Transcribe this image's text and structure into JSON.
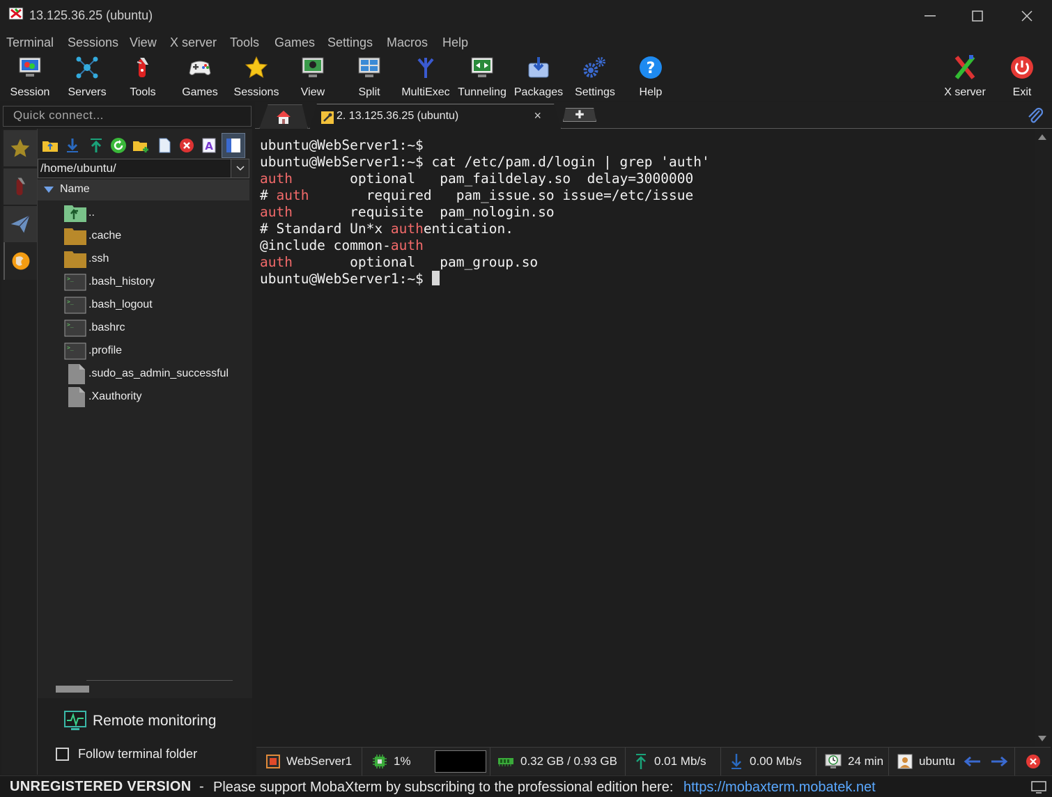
{
  "window": {
    "title": "13.125.36.25 (ubuntu)"
  },
  "menu": [
    "Terminal",
    "Sessions",
    "View",
    "X server",
    "Tools",
    "Games",
    "Settings",
    "Macros",
    "Help"
  ],
  "toolbar": {
    "session": "Session",
    "servers": "Servers",
    "tools": "Tools",
    "games": "Games",
    "sessions": "Sessions",
    "view": "View",
    "split": "Split",
    "multiexec": "MultiExec",
    "tunneling": "Tunneling",
    "packages": "Packages",
    "settings": "Settings",
    "help": "Help",
    "xserver": "X server",
    "exit": "Exit"
  },
  "quick_connect": {
    "placeholder": "Quick connect..."
  },
  "tabs": {
    "active_label": "2. 13.125.36.25 (ubuntu)",
    "close": "×",
    "new": "✚"
  },
  "sidebar": {
    "path": "/home/ubuntu/",
    "column": "Name",
    "files": [
      {
        "name": "..",
        "type": "up"
      },
      {
        "name": ".cache",
        "type": "folder"
      },
      {
        "name": ".ssh",
        "type": "folder"
      },
      {
        "name": ".bash_history",
        "type": "script"
      },
      {
        "name": ".bash_logout",
        "type": "script"
      },
      {
        "name": ".bashrc",
        "type": "script"
      },
      {
        "name": ".profile",
        "type": "script"
      },
      {
        "name": ".sudo_as_admin_successful",
        "type": "file"
      },
      {
        "name": ".Xauthority",
        "type": "file"
      }
    ],
    "remote_monitoring": "Remote monitoring",
    "follow_terminal": "Follow terminal folder"
  },
  "terminal": {
    "lines": [
      [
        {
          "t": "ubuntu@WebServer1:~$"
        }
      ],
      [
        {
          "t": "ubuntu@WebServer1:~$ cat /etc/pam.d/login | grep 'auth'"
        }
      ],
      [
        {
          "t": "auth",
          "c": "red"
        },
        {
          "t": "       optional   pam_faildelay.so  delay=3000000"
        }
      ],
      [
        {
          "t": "# "
        },
        {
          "t": "auth",
          "c": "red"
        },
        {
          "t": "       required   pam_issue.so issue=/etc/issue"
        }
      ],
      [
        {
          "t": "auth",
          "c": "red"
        },
        {
          "t": "       requisite  pam_nologin.so"
        }
      ],
      [
        {
          "t": "# Standard Un*x "
        },
        {
          "t": "auth",
          "c": "red"
        },
        {
          "t": "entication."
        }
      ],
      [
        {
          "t": "@include common-"
        },
        {
          "t": "auth",
          "c": "red"
        }
      ],
      [
        {
          "t": "auth",
          "c": "red"
        },
        {
          "t": "       optional   pam_group.so"
        }
      ],
      [
        {
          "t": "ubuntu@WebServer1:~$ "
        },
        {
          "cursor": true
        }
      ]
    ]
  },
  "status": {
    "host": "WebServer1",
    "cpu": "1%",
    "memory": "0.32 GB / 0.93 GB",
    "upload": "0.01 Mb/s",
    "download": "0.00 Mb/s",
    "uptime": "24 min",
    "user": "ubuntu"
  },
  "footer": {
    "unregistered": "UNREGISTERED VERSION",
    "separator": "-",
    "message": "Please support MobaXterm by subscribing to the professional edition here:",
    "link": "https://mobaxterm.mobatek.net"
  },
  "colors": {
    "accent": "#5aa8ff",
    "highlight": "#f26a6a",
    "background": "#1e1e1e"
  }
}
